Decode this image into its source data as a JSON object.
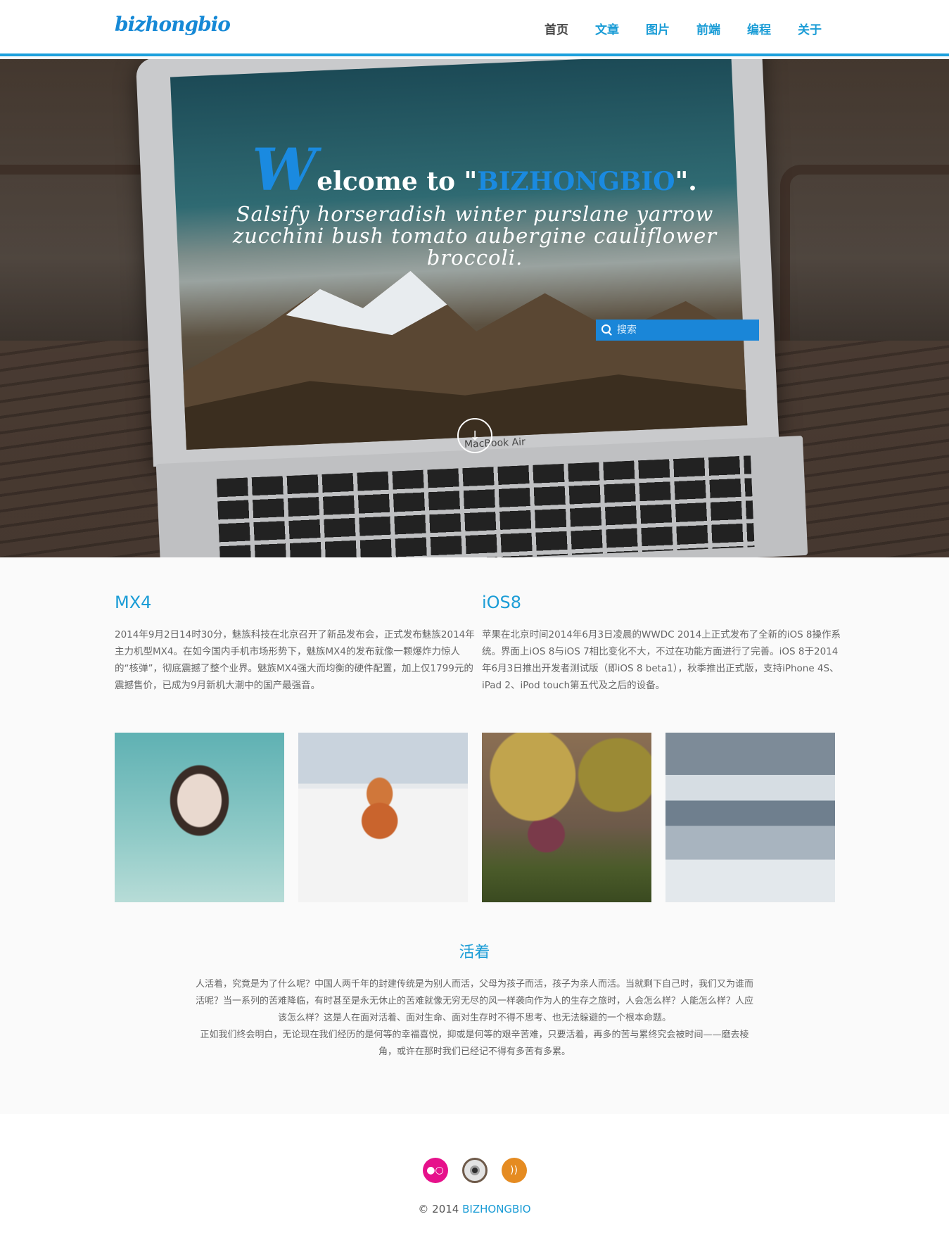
{
  "header": {
    "logo": "bizhongbio",
    "nav": [
      {
        "label": "首页"
      },
      {
        "label": "文章"
      },
      {
        "label": "图片"
      },
      {
        "label": "前端"
      },
      {
        "label": "编程"
      },
      {
        "label": "关于"
      }
    ]
  },
  "hero": {
    "title_first": "W",
    "title_rest": "elcome to \"",
    "title_brand": "BIZHONGBIO",
    "title_end": "\".",
    "subtitle": "Salsify horseradish winter purslane yarrow zucchini bush tomato aubergine cauliflower broccoli.",
    "search_placeholder": "搜索",
    "laptop_label": "MacBook Air",
    "scroll_icon": "arrow-down-icon"
  },
  "columns": [
    {
      "title": "MX4",
      "text": "2014年9月2日14时30分，魅族科技在北京召开了新品发布会，正式发布魅族2014年主力机型MX4。在如今国内手机市场形势下，魅族MX4的发布就像一颗爆炸力惊人的“核弹”，彻底震撼了整个业界。魅族MX4强大而均衡的硬件配置，加上仅1799元的震撼售价，已成为9月新机大潮中的国产最强音。"
    },
    {
      "title": "iOS8",
      "text": "苹果在北京时间2014年6月3日凌晨的WWDC 2014上正式发布了全新的iOS 8操作系统。界面上iOS 8与iOS 7相比变化不大，不过在功能方面进行了完善。iOS 8于2014年6月3日推出开发者测试版（即iOS 8 beta1），秋季推出正式版，支持iPhone 4S、iPad 2、iPod touch第五代及之后的设备。"
    }
  ],
  "essay": {
    "title": "活着",
    "paragraph1": "人活着，究竟是为了什么呢？中国人两千年的封建传统是为别人而活，父母为孩子而活，孩子为亲人而活。当就剩下自己时，我们又为谁而活呢？当一系列的苦难降临，有时甚至是永无休止的苦难就像无穷无尽的风一样袭向作为人的生存之旅时，人会怎么样？人能怎么样？人应该怎么样？这是人在面对活着、面对生命、面对生存时不得不思考、也无法躲避的一个根本命题。",
    "paragraph2": "正如我们终会明白，无论现在我们经历的是何等的幸福喜悦，抑或是何等的艰辛苦难，只要活着，再多的苦与累终究会被时间——磨去棱角，或许在那时我们已经记不得有多苦有多累。"
  },
  "footer": {
    "icons": [
      "flickr-icon",
      "instagram-icon",
      "rss-icon"
    ],
    "copyright_prefix": "© 2014 ",
    "copyright_brand": "BIZHONGBIO"
  },
  "colors": {
    "accent": "#1a9cd6",
    "search_bg": "#1a86d8",
    "flickr": "#e6118b",
    "rss": "#e58b21"
  }
}
